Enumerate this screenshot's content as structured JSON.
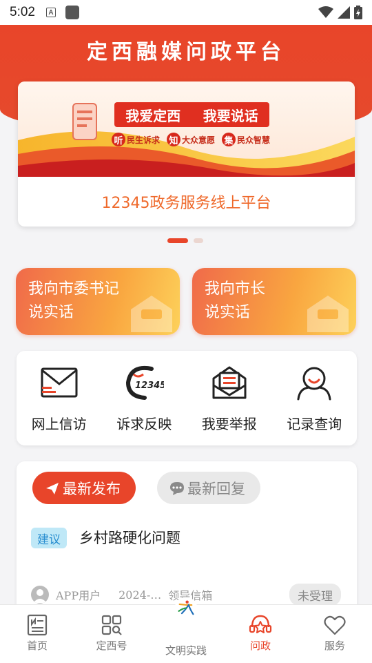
{
  "status_bar": {
    "time": "5:02",
    "notification_icon_letter": "A"
  },
  "header": {
    "title": "定西融媒问政平台"
  },
  "banner": {
    "headline_1": "我爱定西",
    "headline_2": "我要说话",
    "badges": [
      {
        "char": "听",
        "text": "民生诉求"
      },
      {
        "char": "知",
        "text": "大众意愿"
      },
      {
        "char": "集",
        "text": "民众智慧"
      }
    ],
    "caption": "12345政务服务线上平台",
    "page_count": 2,
    "active_page": 1
  },
  "quick_actions": [
    {
      "line1": "我向市委书记",
      "line2": "说实话"
    },
    {
      "line1": "我向市长",
      "line2": "说实话"
    }
  ],
  "services": [
    {
      "label": "网上信访",
      "icon": "envelope-icon"
    },
    {
      "label": "诉求反映",
      "icon": "hotline-12345-icon",
      "icon_text": "12345"
    },
    {
      "label": "我要举报",
      "icon": "report-mail-icon"
    },
    {
      "label": "记录查询",
      "icon": "user-record-icon"
    }
  ],
  "news": {
    "tabs": [
      {
        "label": "最新发布",
        "icon": "send-icon",
        "active": true
      },
      {
        "label": "最新回复",
        "icon": "chat-icon",
        "active": false
      }
    ],
    "items": [
      {
        "tag": "建议",
        "title": "乡村路硬化问题",
        "user": "APP用户",
        "date": "2024-…",
        "target": "领导信箱",
        "status": "未受理"
      }
    ]
  },
  "bottom_nav": [
    {
      "label": "首页",
      "icon": "newspaper-icon",
      "active": false
    },
    {
      "label": "定西号",
      "icon": "grid-search-icon",
      "active": false
    },
    {
      "label": "文明实践",
      "icon": "civilization-logo-icon",
      "active": false
    },
    {
      "label": "问政",
      "icon": "headset-star-icon",
      "active": true
    },
    {
      "label": "服务",
      "icon": "heart-icon",
      "active": false
    }
  ],
  "colors": {
    "brand_red": "#e8452a",
    "caption_orange": "#ef6a2c",
    "tag_blue_bg": "#bfe8f7",
    "tag_blue_text": "#2a8ed0"
  }
}
